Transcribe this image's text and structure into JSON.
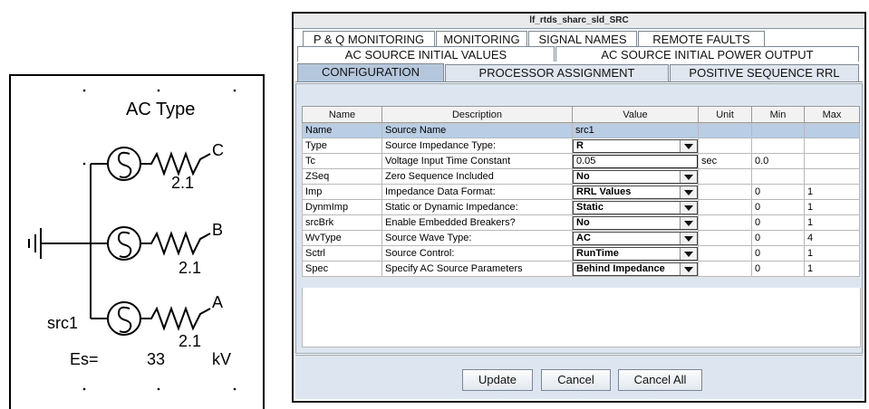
{
  "schematic": {
    "title": "AC Type",
    "phases": [
      {
        "label": "C",
        "value": "2.1"
      },
      {
        "label": "B",
        "value": "2.1"
      },
      {
        "label": "A",
        "value": "2.1"
      }
    ],
    "source_name": "src1",
    "es_label": "Es=",
    "es_value": "33",
    "es_unit": "kV"
  },
  "window": {
    "title": "lf_rtds_sharc_sld_SRC",
    "tabs_row1": [
      "P & Q MONITORING",
      "MONITORING",
      "SIGNAL NAMES",
      "REMOTE FAULTS"
    ],
    "tabs_row2": [
      "AC SOURCE INITIAL VALUES",
      "AC SOURCE INITIAL POWER OUTPUT"
    ],
    "tabs_row3": [
      "CONFIGURATION",
      "PROCESSOR ASSIGNMENT",
      "POSITIVE SEQUENCE RRL"
    ],
    "active_tab": "CONFIGURATION"
  },
  "table": {
    "columns": [
      "Name",
      "Description",
      "Value",
      "Unit",
      "Min",
      "Max"
    ],
    "rows": [
      {
        "name": "Name",
        "desc": "Source Name",
        "value": "src1",
        "kind": "text",
        "unit": "",
        "min": "",
        "max": "",
        "selected": true
      },
      {
        "name": "Type",
        "desc": "Source Impedance Type:",
        "value": "R",
        "kind": "combo",
        "unit": "",
        "min": "",
        "max": ""
      },
      {
        "name": "Tc",
        "desc": "Voltage Input Time Constant",
        "value": "0.05",
        "kind": "edit",
        "unit": "sec",
        "min": "0.0",
        "max": ""
      },
      {
        "name": "ZSeq",
        "desc": "Zero Sequence Included",
        "value": "No",
        "kind": "combo",
        "unit": "",
        "min": "",
        "max": ""
      },
      {
        "name": "Imp",
        "desc": "Impedance Data Format:",
        "value": "RRL Values",
        "kind": "combo",
        "unit": "",
        "min": "0",
        "max": "1"
      },
      {
        "name": "DynmImp",
        "desc": "Static or Dynamic Impedance:",
        "value": "Static",
        "kind": "combo",
        "unit": "",
        "min": "0",
        "max": "1"
      },
      {
        "name": "srcBrk",
        "desc": "Enable Embedded Breakers?",
        "value": "No",
        "kind": "combo",
        "unit": "",
        "min": "0",
        "max": "1"
      },
      {
        "name": "WvType",
        "desc": "Source Wave Type:",
        "value": "AC",
        "kind": "combo",
        "unit": "",
        "min": "0",
        "max": "4"
      },
      {
        "name": "Sctrl",
        "desc": "Source Control:",
        "value": "RunTime",
        "kind": "combo",
        "unit": "",
        "min": "0",
        "max": "1"
      },
      {
        "name": "Spec",
        "desc": "Specify AC Source Parameters",
        "value": "Behind Impedance",
        "kind": "combo",
        "unit": "",
        "min": "0",
        "max": "1"
      }
    ]
  },
  "buttons": {
    "update": "Update",
    "cancel": "Cancel",
    "cancel_all": "Cancel All"
  },
  "colors": {
    "active_tab": "#b4c7dd",
    "selected_row": "#b9cde4",
    "panel_bg": "#dde6f0"
  }
}
